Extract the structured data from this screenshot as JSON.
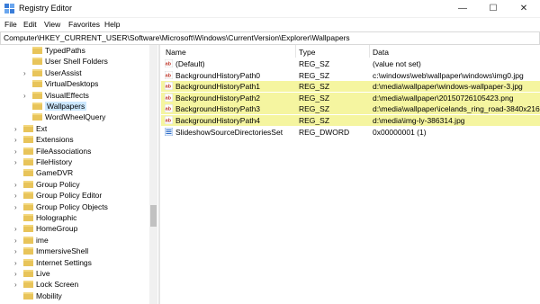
{
  "window": {
    "title": "Registry Editor"
  },
  "menu": [
    "File",
    "Edit",
    "View",
    "Favorites",
    "Help"
  ],
  "address": "Computer\\HKEY_CURRENT_USER\\Software\\Microsoft\\Windows\\CurrentVersion\\Explorer\\Wallpapers",
  "tree": [
    {
      "label": "TypedPaths",
      "indent": 1,
      "expander": ""
    },
    {
      "label": "User Shell Folders",
      "indent": 1,
      "expander": ""
    },
    {
      "label": "UserAssist",
      "indent": 1,
      "expander": "›"
    },
    {
      "label": "VirtualDesktops",
      "indent": 1,
      "expander": ""
    },
    {
      "label": "VisualEffects",
      "indent": 1,
      "expander": "›"
    },
    {
      "label": "Wallpapers",
      "indent": 1,
      "expander": "",
      "selected": true
    },
    {
      "label": "WordWheelQuery",
      "indent": 1,
      "expander": ""
    },
    {
      "label": "Ext",
      "indent": 0,
      "expander": "›"
    },
    {
      "label": "Extensions",
      "indent": 0,
      "expander": "›"
    },
    {
      "label": "FileAssociations",
      "indent": 0,
      "expander": "›"
    },
    {
      "label": "FileHistory",
      "indent": 0,
      "expander": "›"
    },
    {
      "label": "GameDVR",
      "indent": 0,
      "expander": ""
    },
    {
      "label": "Group Policy",
      "indent": 0,
      "expander": "›"
    },
    {
      "label": "Group Policy Editor",
      "indent": 0,
      "expander": "›"
    },
    {
      "label": "Group Policy Objects",
      "indent": 0,
      "expander": "›"
    },
    {
      "label": "Holographic",
      "indent": 0,
      "expander": ""
    },
    {
      "label": "HomeGroup",
      "indent": 0,
      "expander": "›"
    },
    {
      "label": "ime",
      "indent": 0,
      "expander": "›"
    },
    {
      "label": "ImmersiveShell",
      "indent": 0,
      "expander": "›"
    },
    {
      "label": "Internet Settings",
      "indent": 0,
      "expander": "›"
    },
    {
      "label": "Live",
      "indent": 0,
      "expander": "›"
    },
    {
      "label": "Lock Screen",
      "indent": 0,
      "expander": "›"
    },
    {
      "label": "Mobility",
      "indent": 0,
      "expander": ""
    }
  ],
  "columns": {
    "name": "Name",
    "type": "Type",
    "data": "Data"
  },
  "values": [
    {
      "name": "(Default)",
      "type": "REG_SZ",
      "data": "(value not set)",
      "icon": "ab",
      "highlight": false
    },
    {
      "name": "BackgroundHistoryPath0",
      "type": "REG_SZ",
      "data": "c:\\windows\\web\\wallpaper\\windows\\img0.jpg",
      "icon": "ab",
      "highlight": false
    },
    {
      "name": "BackgroundHistoryPath1",
      "type": "REG_SZ",
      "data": "d:\\media\\wallpaper\\windows-wallpaper-3.jpg",
      "icon": "ab",
      "highlight": true
    },
    {
      "name": "BackgroundHistoryPath2",
      "type": "REG_SZ",
      "data": "d:\\media\\wallpaper\\20150726105423.png",
      "icon": "ab",
      "highlight": true
    },
    {
      "name": "BackgroundHistoryPath3",
      "type": "REG_SZ",
      "data": "d:\\media\\wallpaper\\icelands_ring_road-3840x2160...",
      "icon": "ab",
      "highlight": true
    },
    {
      "name": "BackgroundHistoryPath4",
      "type": "REG_SZ",
      "data": "d:\\media\\img-ly-386314.jpg",
      "icon": "ab",
      "highlight": true
    },
    {
      "name": "SlideshowSourceDirectoriesSet",
      "type": "REG_DWORD",
      "data": "0x00000001 (1)",
      "icon": "bin",
      "highlight": false
    }
  ],
  "colors": {
    "highlight": "#f5f5a0",
    "selected": "#cce8ff",
    "folder": "#e8c45a"
  }
}
